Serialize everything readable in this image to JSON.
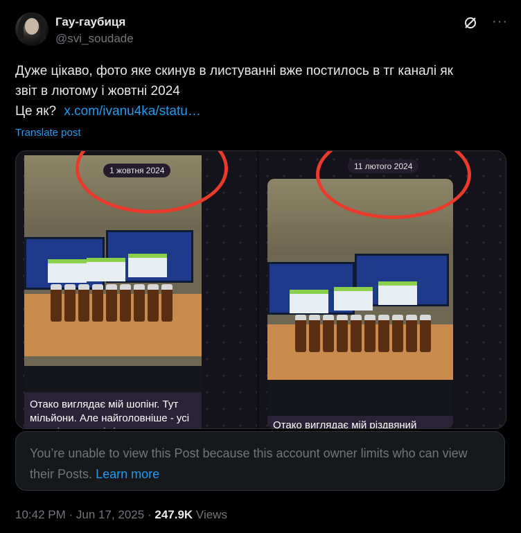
{
  "author": {
    "display_name": "Гау-гаубиця",
    "handle": "@svi_soudade"
  },
  "post": {
    "text_line1": "Дуже цікаво, фото яке скинув в листуванні вже постилось в тг каналі як",
    "text_line2": "звіт в лютому і жовтні 2024",
    "text_line3": "Це як?",
    "link": "x.com/ivanu4ka/statu…",
    "translate_label": "Translate post"
  },
  "media": {
    "left": {
      "date": "1 жовтня 2024",
      "caption": "Отако виглядає мій шопінг. Тут мільйони. Але найголовніше - усі ви. І ті, хто тут, і ті, хто не тут"
    },
    "right": {
      "date": "11 лютого 2024",
      "caption": "Отако виглядає мій різдвяний"
    }
  },
  "unavailable": {
    "message": "You’re unable to view this Post because this account owner limits who can view their Posts.",
    "learn_more": "Learn more"
  },
  "meta": {
    "time": "10:42 PM",
    "separator": "·",
    "date": "Jun 17, 2025",
    "views_count": "247.9K",
    "views_label": "Views"
  },
  "icons": {
    "grok": "grok-icon",
    "more": "more-icon"
  },
  "colors": {
    "background": "#000000",
    "link": "#1d9bf0",
    "secondary_text": "#71767b",
    "annotation_red": "#e93a2c"
  }
}
